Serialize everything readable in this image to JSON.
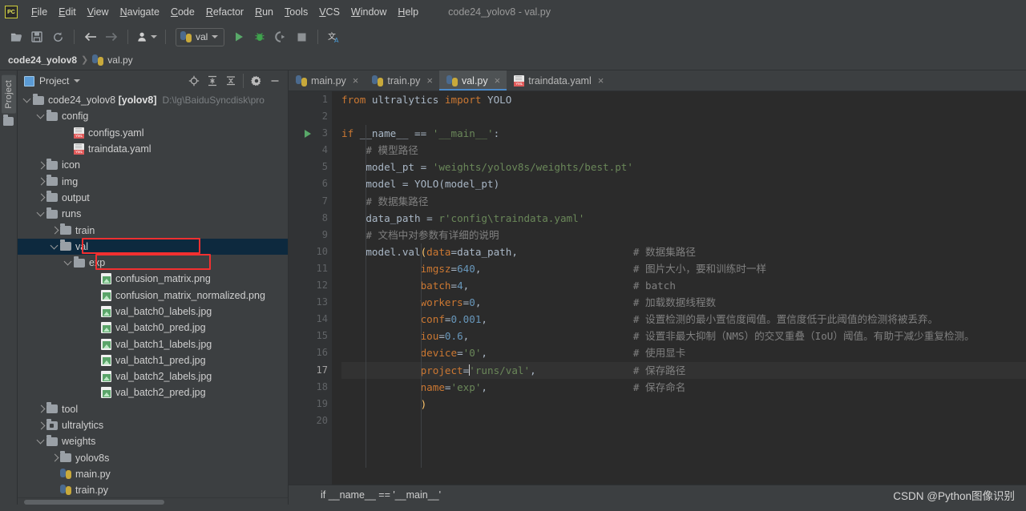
{
  "window": {
    "title": "code24_yolov8 - val.py",
    "logo_text": "PC"
  },
  "menubar": {
    "items": [
      {
        "label": "File"
      },
      {
        "label": "Edit"
      },
      {
        "label": "View"
      },
      {
        "label": "Navigate"
      },
      {
        "label": "Code"
      },
      {
        "label": "Refactor"
      },
      {
        "label": "Run"
      },
      {
        "label": "Tools"
      },
      {
        "label": "VCS"
      },
      {
        "label": "Window"
      },
      {
        "label": "Help"
      }
    ]
  },
  "toolbar": {
    "icons": [
      {
        "name": "open-folder-icon",
        "glyph": "🗁"
      },
      {
        "name": "save-all-icon",
        "glyph": "💾"
      },
      {
        "name": "sync-icon",
        "glyph": "⟳"
      },
      {
        "name": "back-icon",
        "glyph": "←"
      },
      {
        "name": "forward-icon",
        "glyph": "→"
      },
      {
        "name": "user-icon",
        "glyph": "👤"
      }
    ],
    "run_config": "val",
    "run_label": "Run",
    "debug_label": "Debug",
    "coverage_label": "Run with Coverage",
    "stop_label": "Stop",
    "translate_label": "Translate"
  },
  "breadcrumb": {
    "project": "code24_yolov8",
    "separator": "❯",
    "file": "val.py"
  },
  "left_strip": {
    "project_tab": "Project"
  },
  "project_panel": {
    "title": "Project",
    "tools": [
      {
        "name": "locate-icon"
      },
      {
        "name": "expand-all-icon"
      },
      {
        "name": "collapse-all-icon"
      },
      {
        "name": "settings-gear-icon"
      },
      {
        "name": "hide-icon"
      }
    ],
    "tree": [
      {
        "depth": 0,
        "arrow": "d",
        "icon": "folder",
        "label": "code24_yolov8 ",
        "bold": "[yolov8]",
        "path": "D:\\lg\\BaiduSyncdisk\\pro"
      },
      {
        "depth": 1,
        "arrow": "d",
        "icon": "folder",
        "label": "config"
      },
      {
        "depth": 3,
        "arrow": "",
        "icon": "yml",
        "label": "configs.yaml"
      },
      {
        "depth": 3,
        "arrow": "",
        "icon": "yml",
        "label": "traindata.yaml"
      },
      {
        "depth": 1,
        "arrow": "r",
        "icon": "folder",
        "label": "icon"
      },
      {
        "depth": 1,
        "arrow": "r",
        "icon": "folder",
        "label": "img"
      },
      {
        "depth": 1,
        "arrow": "r",
        "icon": "folder",
        "label": "output"
      },
      {
        "depth": 1,
        "arrow": "d",
        "icon": "folder",
        "label": "runs"
      },
      {
        "depth": 2,
        "arrow": "r",
        "icon": "folder",
        "label": "train"
      },
      {
        "depth": 2,
        "arrow": "d",
        "icon": "folder",
        "label": "val",
        "selected": true,
        "highlight": true
      },
      {
        "depth": 3,
        "arrow": "d",
        "icon": "folder",
        "label": "exp",
        "highlight": true
      },
      {
        "depth": 5,
        "arrow": "",
        "icon": "img",
        "label": "confusion_matrix.png"
      },
      {
        "depth": 5,
        "arrow": "",
        "icon": "img",
        "label": "confusion_matrix_normalized.png"
      },
      {
        "depth": 5,
        "arrow": "",
        "icon": "img",
        "label": "val_batch0_labels.jpg"
      },
      {
        "depth": 5,
        "arrow": "",
        "icon": "img",
        "label": "val_batch0_pred.jpg"
      },
      {
        "depth": 5,
        "arrow": "",
        "icon": "img",
        "label": "val_batch1_labels.jpg"
      },
      {
        "depth": 5,
        "arrow": "",
        "icon": "img",
        "label": "val_batch1_pred.jpg"
      },
      {
        "depth": 5,
        "arrow": "",
        "icon": "img",
        "label": "val_batch2_labels.jpg"
      },
      {
        "depth": 5,
        "arrow": "",
        "icon": "img",
        "label": "val_batch2_pred.jpg"
      },
      {
        "depth": 1,
        "arrow": "r",
        "icon": "folder",
        "label": "tool"
      },
      {
        "depth": 1,
        "arrow": "r",
        "icon": "folder-mod",
        "label": "ultralytics"
      },
      {
        "depth": 1,
        "arrow": "d",
        "icon": "folder",
        "label": "weights"
      },
      {
        "depth": 2,
        "arrow": "r",
        "icon": "folder",
        "label": "yolov8s"
      },
      {
        "depth": 2,
        "arrow": "",
        "icon": "py",
        "label": "main.py"
      },
      {
        "depth": 2,
        "arrow": "",
        "icon": "py",
        "label": "train.py"
      }
    ]
  },
  "editor": {
    "tabs": [
      {
        "label": "main.py",
        "icon": "python-file-icon",
        "active": false
      },
      {
        "label": "train.py",
        "icon": "python-file-icon",
        "active": false
      },
      {
        "label": "val.py",
        "icon": "python-file-icon",
        "active": true
      },
      {
        "label": "traindata.yaml",
        "icon": "yaml-file-icon",
        "active": false
      }
    ],
    "close_glyph": "×",
    "line_numbers": [
      "1",
      "2",
      "3",
      "4",
      "5",
      "6",
      "7",
      "8",
      "9",
      "10",
      "11",
      "12",
      "13",
      "14",
      "15",
      "16",
      "17",
      "18",
      "19",
      "20"
    ],
    "current_line": 17,
    "lines": [
      {
        "n": 1,
        "tokens": [
          {
            "t": "from ",
            "c": "kw"
          },
          {
            "t": "ultralytics ",
            "c": "id"
          },
          {
            "t": "import ",
            "c": "kw"
          },
          {
            "t": "YOLO",
            "c": "id"
          }
        ]
      },
      {
        "n": 2,
        "tokens": []
      },
      {
        "n": 3,
        "tokens": [
          {
            "t": "if ",
            "c": "kw"
          },
          {
            "t": "__name__ ",
            "c": "id"
          },
          {
            "t": "== ",
            "c": "id"
          },
          {
            "t": "'__main__'",
            "c": "str"
          },
          {
            "t": ":",
            "c": "id"
          }
        ]
      },
      {
        "n": 4,
        "tokens": [
          {
            "t": "    # 模型路径",
            "c": "cmt"
          }
        ]
      },
      {
        "n": 5,
        "tokens": [
          {
            "t": "    model_pt ",
            "c": "id"
          },
          {
            "t": "= ",
            "c": "id"
          },
          {
            "t": "'weights/yolov8s/weights/best.pt'",
            "c": "str"
          }
        ]
      },
      {
        "n": 6,
        "tokens": [
          {
            "t": "    model ",
            "c": "id"
          },
          {
            "t": "= ",
            "c": "id"
          },
          {
            "t": "YOLO",
            "c": "id"
          },
          {
            "t": "(",
            "c": "brc"
          },
          {
            "t": "model_pt",
            "c": "id"
          },
          {
            "t": ")",
            "c": "brc"
          }
        ]
      },
      {
        "n": 7,
        "tokens": [
          {
            "t": "    # 数据集路径",
            "c": "cmt"
          }
        ]
      },
      {
        "n": 8,
        "tokens": [
          {
            "t": "    data_path ",
            "c": "id"
          },
          {
            "t": "= ",
            "c": "id"
          },
          {
            "t": "r'config\\traindata.yaml'",
            "c": "str"
          }
        ]
      },
      {
        "n": 9,
        "tokens": [
          {
            "t": "    # 文档中对参数有详细的说明",
            "c": "cmt"
          }
        ]
      },
      {
        "n": 10,
        "tokens": [
          {
            "t": "    model.val",
            "c": "id"
          },
          {
            "t": "(",
            "c": "yellowbrc"
          },
          {
            "t": "data",
            "c": "prm"
          },
          {
            "t": "=",
            "c": "id"
          },
          {
            "t": "data_path",
            "c": "id"
          },
          {
            "t": ",",
            "c": "id"
          }
        ],
        "comment": "# 数据集路径"
      },
      {
        "n": 11,
        "tokens": [
          {
            "t": "             imgsz",
            "c": "prm"
          },
          {
            "t": "=",
            "c": "id"
          },
          {
            "t": "640",
            "c": "num"
          },
          {
            "t": ",",
            "c": "id"
          }
        ],
        "comment": "# 图片大小，要和训练时一样"
      },
      {
        "n": 12,
        "tokens": [
          {
            "t": "             batch",
            "c": "prm"
          },
          {
            "t": "=",
            "c": "id"
          },
          {
            "t": "4",
            "c": "num"
          },
          {
            "t": ",",
            "c": "id"
          }
        ],
        "comment": "# batch"
      },
      {
        "n": 13,
        "tokens": [
          {
            "t": "             workers",
            "c": "prm"
          },
          {
            "t": "=",
            "c": "id"
          },
          {
            "t": "0",
            "c": "num"
          },
          {
            "t": ",",
            "c": "id"
          }
        ],
        "comment": "# 加载数据线程数"
      },
      {
        "n": 14,
        "tokens": [
          {
            "t": "             conf",
            "c": "prm"
          },
          {
            "t": "=",
            "c": "id"
          },
          {
            "t": "0.001",
            "c": "num"
          },
          {
            "t": ",",
            "c": "id"
          }
        ],
        "comment": "# 设置检测的最小置信度阈值。置信度低于此阈值的检测将被丢弃。"
      },
      {
        "n": 15,
        "tokens": [
          {
            "t": "             iou",
            "c": "prm"
          },
          {
            "t": "=",
            "c": "id"
          },
          {
            "t": "0.6",
            "c": "num"
          },
          {
            "t": ",",
            "c": "id"
          }
        ],
        "comment": "# 设置非最大抑制（NMS）的交叉重叠（IoU）阈值。有助于减少重复检测。"
      },
      {
        "n": 16,
        "tokens": [
          {
            "t": "             device",
            "c": "prm"
          },
          {
            "t": "=",
            "c": "id"
          },
          {
            "t": "'0'",
            "c": "str"
          },
          {
            "t": ",",
            "c": "id"
          }
        ],
        "comment": "# 使用显卡"
      },
      {
        "n": 17,
        "tokens": [
          {
            "t": "             project",
            "c": "prm"
          },
          {
            "t": "=",
            "c": "id"
          },
          {
            "t": "'runs/val'",
            "c": "str"
          },
          {
            "t": ",",
            "c": "id"
          }
        ],
        "comment": "# 保存路径",
        "caret_after": 2
      },
      {
        "n": 18,
        "tokens": [
          {
            "t": "             name",
            "c": "prm"
          },
          {
            "t": "=",
            "c": "id"
          },
          {
            "t": "'exp'",
            "c": "str"
          },
          {
            "t": ",",
            "c": "id"
          }
        ],
        "comment": "# 保存命名"
      },
      {
        "n": 19,
        "tokens": [
          {
            "t": "             )",
            "c": "yellowbrc"
          }
        ]
      },
      {
        "n": 20,
        "tokens": []
      }
    ]
  },
  "bottom": {
    "breadcrumb": "if __name__ == '__main__'",
    "watermark": "CSDN @Python图像识别"
  },
  "colors": {
    "accent_blue": "#4a88c7",
    "selection_blue": "#0d293e",
    "annotation_red": "#f33030",
    "keyword_orange": "#cc7832",
    "string_green": "#6a8759",
    "number_blue": "#6897bb",
    "comment_gray": "#808080",
    "function_yellow": "#ffc66d",
    "editor_bg": "#2b2b2b",
    "panel_bg": "#3c3f41"
  }
}
